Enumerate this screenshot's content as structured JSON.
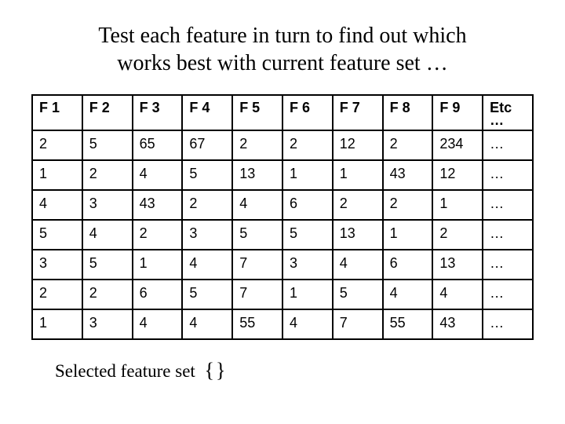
{
  "title_line1": "Test each feature in turn to find out which",
  "title_line2": "works best with current feature set …",
  "headers": [
    "F 1",
    "F 2",
    "F 3",
    "F 4",
    "F 5",
    "F 6",
    "F 7",
    "F 8",
    "F 9",
    "Etc"
  ],
  "header_etc_dots": "…",
  "rows": [
    [
      "2",
      "5",
      "65",
      "67",
      "2",
      "2",
      "12",
      "2",
      "234",
      "…"
    ],
    [
      "1",
      "2",
      "4",
      "5",
      "13",
      "1",
      "1",
      "43",
      "12",
      "…"
    ],
    [
      "4",
      "3",
      "43",
      "2",
      "4",
      "6",
      "2",
      "2",
      "1",
      "…"
    ],
    [
      "5",
      "4",
      "2",
      "3",
      "5",
      "5",
      "13",
      "1",
      "2",
      "…"
    ],
    [
      "3",
      "5",
      "1",
      "4",
      "7",
      "3",
      "4",
      "6",
      "13",
      "…"
    ],
    [
      "2",
      "2",
      "6",
      "5",
      "7",
      "1",
      "5",
      "4",
      "4",
      "…"
    ],
    [
      "1",
      "3",
      "4",
      "4",
      "55",
      "4",
      "7",
      "55",
      "43",
      "…"
    ]
  ],
  "footer_label": "Selected feature set",
  "footer_braces": "{}",
  "chart_data": {
    "type": "table",
    "title": "Test each feature in turn to find out which works best with current feature set …",
    "columns": [
      "F 1",
      "F 2",
      "F 3",
      "F 4",
      "F 5",
      "F 6",
      "F 7",
      "F 8",
      "F 9",
      "Etc …"
    ],
    "data": [
      [
        2,
        5,
        65,
        67,
        2,
        2,
        12,
        2,
        234,
        null
      ],
      [
        1,
        2,
        4,
        5,
        13,
        1,
        1,
        43,
        12,
        null
      ],
      [
        4,
        3,
        43,
        2,
        4,
        6,
        2,
        2,
        1,
        null
      ],
      [
        5,
        4,
        2,
        3,
        5,
        5,
        13,
        1,
        2,
        null
      ],
      [
        3,
        5,
        1,
        4,
        7,
        3,
        4,
        6,
        13,
        null
      ],
      [
        2,
        2,
        6,
        5,
        7,
        1,
        5,
        4,
        4,
        null
      ],
      [
        1,
        3,
        4,
        4,
        55,
        4,
        7,
        55,
        43,
        null
      ]
    ],
    "footer": "Selected feature set {}"
  }
}
